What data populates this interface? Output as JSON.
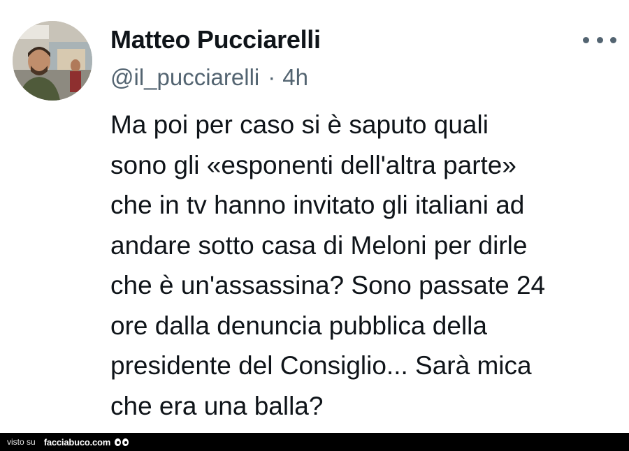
{
  "tweet": {
    "author_name": "Matteo Pucciarelli",
    "handle": "@il_pucciarelli",
    "separator": "·",
    "time": "4h",
    "text_lines": [
      "Ma poi per caso si è saputo quali",
      "sono gli «esponenti dell'altra parte»",
      "che in tv hanno invitato gli italiani ad",
      "andare sotto casa di Meloni per dirle",
      "che è un'assassina? Sono passate 24",
      "ore dalla denuncia pubblica della",
      "presidente del Consiglio... Sarà mica",
      "che era una balla?"
    ],
    "more_icon": "more-horizontal-icon"
  },
  "footer": {
    "visto_label": "visto su",
    "site_label": "facciabuco.com",
    "logo_icon": "eyes-icon"
  },
  "colors": {
    "text": "#0f1419",
    "secondary": "#536471",
    "footer_bg": "#000000"
  }
}
